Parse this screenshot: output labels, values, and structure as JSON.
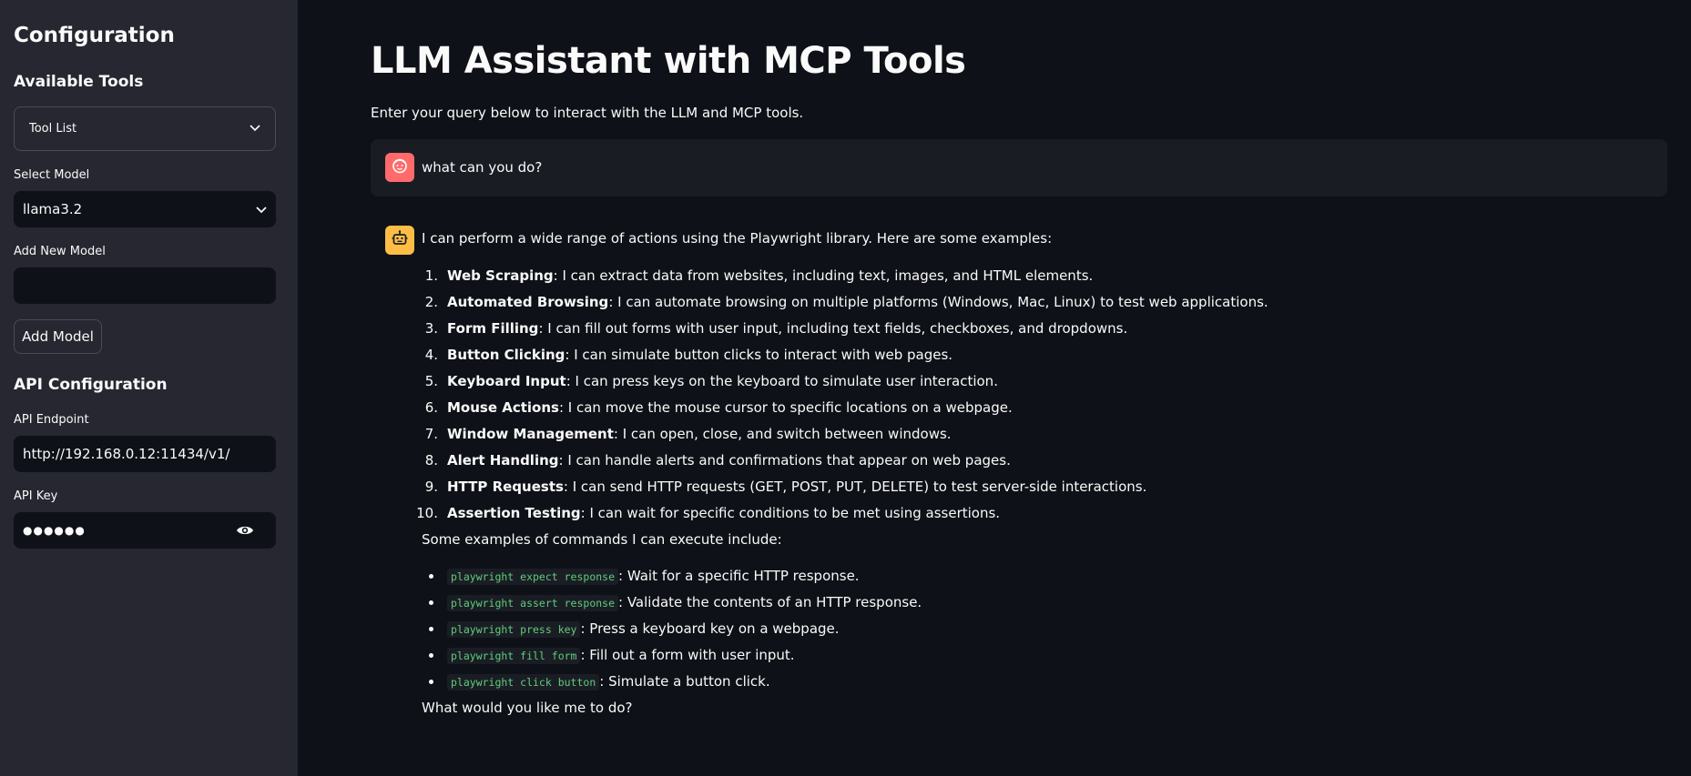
{
  "sidebar": {
    "title": "Configuration",
    "tools_heading": "Available Tools",
    "tool_list_label": "Tool List",
    "select_model_label": "Select Model",
    "selected_model": "llama3.2",
    "add_new_model_label": "Add New Model",
    "add_new_model_value": "",
    "add_model_button": "Add Model",
    "api_heading": "API Configuration",
    "api_endpoint_label": "API Endpoint",
    "api_endpoint_value": "http://192.168.0.12:11434/v1/",
    "api_key_label": "API Key",
    "api_key_masked": "●●●●●●"
  },
  "main": {
    "title": "LLM Assistant with MCP Tools",
    "caption": "Enter your query below to interact with the LLM and MCP tools.",
    "user_message": "what can you do?",
    "assistant": {
      "intro": "I can perform a wide range of actions using the Playwright library. Here are some examples:",
      "items": [
        {
          "num": "1.",
          "title": "Web Scraping",
          "text": ": I can extract data from websites, including text, images, and HTML elements."
        },
        {
          "num": "2.",
          "title": "Automated Browsing",
          "text": ": I can automate browsing on multiple platforms (Windows, Mac, Linux) to test web applications."
        },
        {
          "num": "3.",
          "title": "Form Filling",
          "text": ": I can fill out forms with user input, including text fields, checkboxes, and dropdowns."
        },
        {
          "num": "4.",
          "title": "Button Clicking",
          "text": ": I can simulate button clicks to interact with web pages."
        },
        {
          "num": "5.",
          "title": "Keyboard Input",
          "text": ": I can press keys on the keyboard to simulate user interaction."
        },
        {
          "num": "6.",
          "title": "Mouse Actions",
          "text": ": I can move the mouse cursor to specific locations on a webpage."
        },
        {
          "num": "7.",
          "title": "Window Management",
          "text": ": I can open, close, and switch between windows."
        },
        {
          "num": "8.",
          "title": "Alert Handling",
          "text": ": I can handle alerts and confirmations that appear on web pages."
        },
        {
          "num": "9.",
          "title": "HTTP Requests",
          "text": ": I can send HTTP requests (GET, POST, PUT, DELETE) to test server-side interactions."
        },
        {
          "num": "10.",
          "title": "Assertion Testing",
          "text": ": I can wait for specific conditions to be met using assertions."
        }
      ],
      "examples_intro": "Some examples of commands I can execute include:",
      "commands": [
        {
          "code": "playwright expect response",
          "text": ": Wait for a specific HTTP response."
        },
        {
          "code": "playwright assert response",
          "text": ": Validate the contents of an HTTP response."
        },
        {
          "code": "playwright press key",
          "text": ": Press a keyboard key on a webpage."
        },
        {
          "code": "playwright fill form",
          "text": ": Fill out a form with user input."
        },
        {
          "code": "playwright click button",
          "text": ": Simulate a button click."
        }
      ],
      "closing": "What would you like me to do?"
    }
  },
  "colors": {
    "background": "#0e1117",
    "sidebar": "#262730",
    "user_avatar": "#ff6b6b",
    "bot_avatar": "#ffbd45",
    "code": "#5ece7b"
  }
}
